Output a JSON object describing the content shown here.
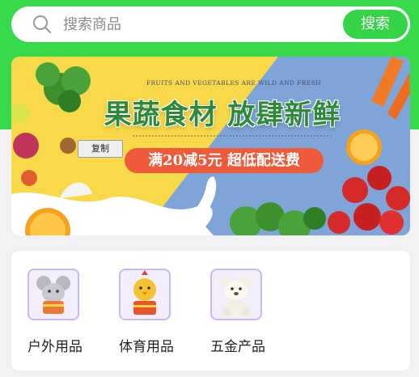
{
  "search": {
    "placeholder": "搜索商品",
    "button_label": "搜索"
  },
  "banner": {
    "subtitle": "FRUITS AND VEGETABLES ARE WILD AND FRESH",
    "title": "果蔬食材 放肆新鲜",
    "promo": "满20减5元 超低配送费",
    "copy_button": "复制"
  },
  "categories": [
    {
      "label": "户外用品",
      "icon": "mouse-toy-icon"
    },
    {
      "label": "体育用品",
      "icon": "chick-toy-icon"
    },
    {
      "label": "五金产品",
      "icon": "bear-toy-icon"
    }
  ],
  "colors": {
    "header_green": "#38d94a",
    "button_green": "#34d446",
    "promo_red": "#ef5a3a",
    "icon_border": "#cbb8ee"
  }
}
